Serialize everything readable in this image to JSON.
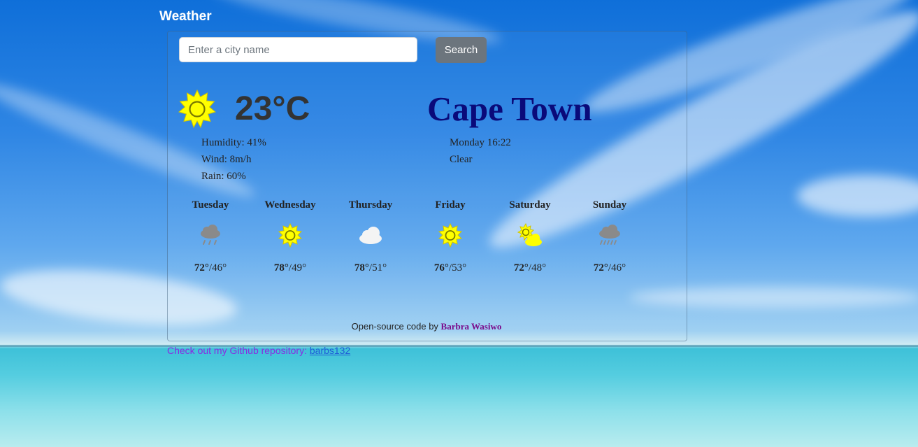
{
  "app": {
    "title": "Weather"
  },
  "search": {
    "placeholder": "Enter a city name",
    "value": "",
    "button_label": "Search"
  },
  "current": {
    "icon": "sun-icon",
    "temperature": "23°C",
    "city": "Cape Town",
    "humidity": "Humidity: 41%",
    "wind": "Wind: 8m/h",
    "rain": "Rain: 60%",
    "datetime": "Monday 16:22",
    "condition": "Clear"
  },
  "forecast": [
    {
      "day": "Tuesday",
      "icon": "rain-cloud-icon",
      "high": "72°",
      "low": "/46°"
    },
    {
      "day": "Wednesday",
      "icon": "sun-icon",
      "high": "78°",
      "low": "/49°"
    },
    {
      "day": "Thursday",
      "icon": "cloud-icon",
      "high": "78°",
      "low": "/51°"
    },
    {
      "day": "Friday",
      "icon": "sun-icon",
      "high": "76°",
      "low": "/53°"
    },
    {
      "day": "Saturday",
      "icon": "sun-cloud-icon",
      "high": "72°",
      "low": "/48°"
    },
    {
      "day": "Sunday",
      "icon": "shower-cloud-icon",
      "high": "72°",
      "low": "/46°"
    }
  ],
  "footer": {
    "prefix": "Open-source code by ",
    "author": "Barbra Wasiwo"
  },
  "repo": {
    "text": "Check out my Github repository: ",
    "link": "barbs132"
  },
  "colors": {
    "sun": "#ffff00",
    "city": "#0a0a7a",
    "author": "#7a0a8a",
    "button": "#6c757d"
  }
}
